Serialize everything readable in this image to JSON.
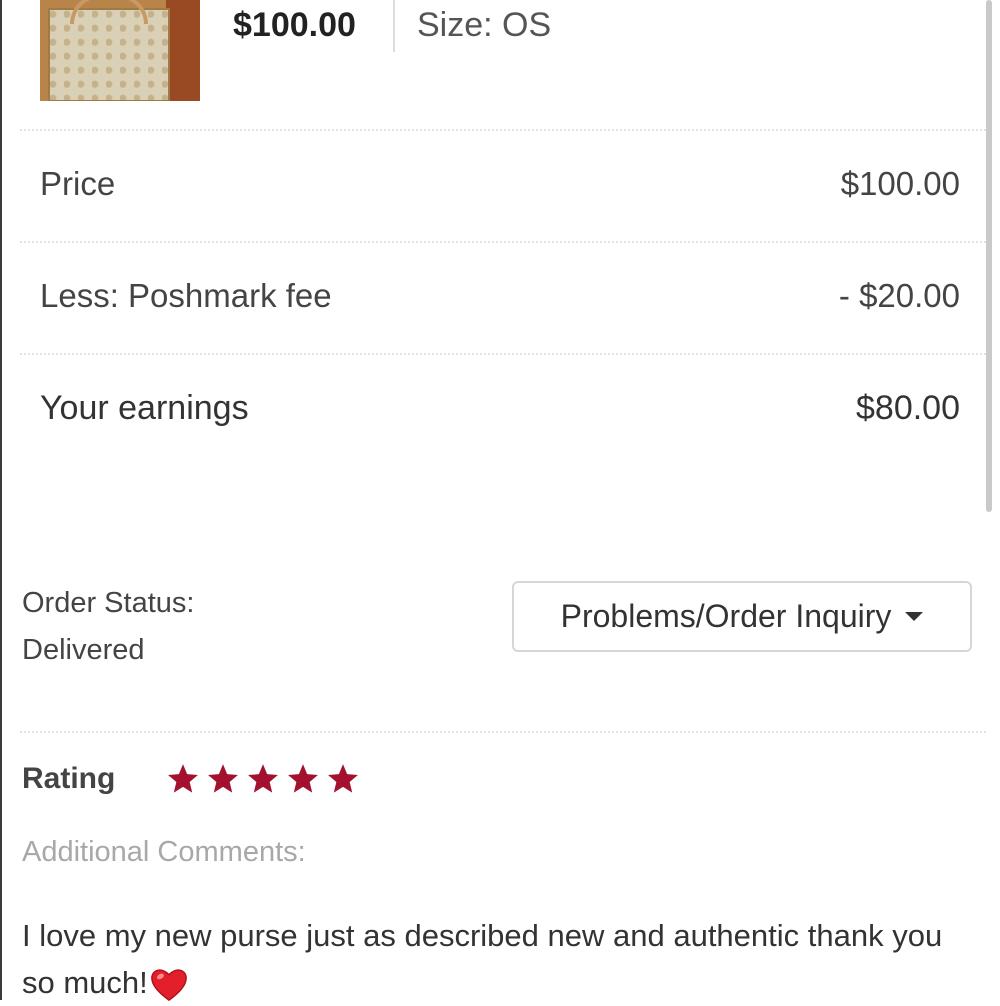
{
  "listing": {
    "price": "$100.00",
    "size": "Size: OS"
  },
  "earnings": {
    "price_label": "Price",
    "price_value": "$100.00",
    "fee_label": "Less: Poshmark fee",
    "fee_value": "- $20.00",
    "earnings_label": "Your earnings",
    "earnings_value": "$80.00"
  },
  "order": {
    "status_label": "Order Status:",
    "status_value": "Delivered",
    "inquiry_button": "Problems/Order Inquiry"
  },
  "rating": {
    "label": "Rating",
    "stars": 5,
    "max_stars": 5,
    "star_color": "#a3112e",
    "comments_label": "Additional Comments:",
    "comment_text": "I love my new purse just as described new and authentic thank you so much!"
  },
  "icons": [
    "star-icon",
    "heart-icon",
    "chevron-down-icon"
  ]
}
